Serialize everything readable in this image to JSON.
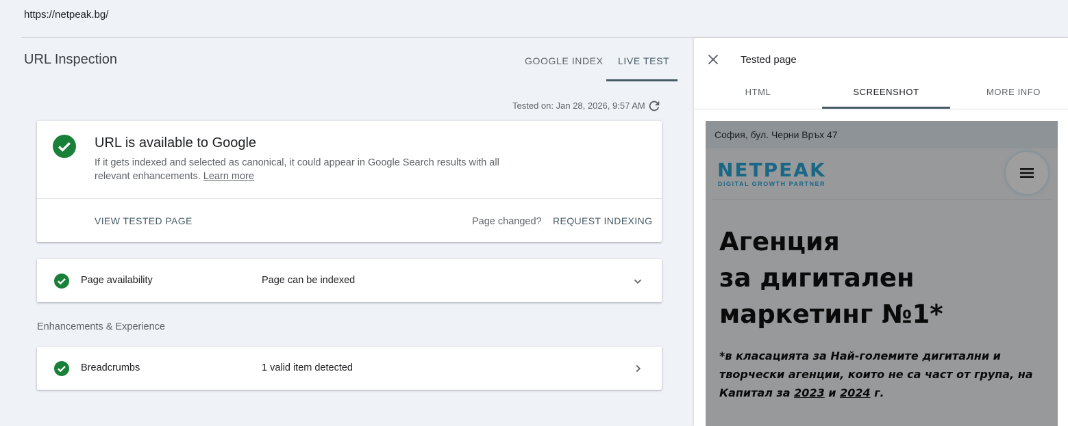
{
  "address_bar": {
    "url": "https://netpeak.bg/"
  },
  "header": {
    "title": "URL Inspection",
    "tabs": [
      {
        "label": "GOOGLE INDEX",
        "active": false
      },
      {
        "label": "LIVE TEST",
        "active": true
      }
    ]
  },
  "test_info": {
    "tested_on": "Tested on: Jan 28, 2026, 9:57 AM",
    "refresh_icon": "refresh-icon"
  },
  "status_card": {
    "icon": "check-circle-icon",
    "headline": "URL is available to Google",
    "description": "If it gets indexed and selected as canonical, it could appear in Google Search results with all relevant enhancements.",
    "learn_more": "Learn more",
    "view_button": "VIEW TESTED PAGE",
    "page_changed": "Page changed?",
    "request_button": "REQUEST INDEXING"
  },
  "availability": {
    "label": "Page availability",
    "value": "Page can be indexed",
    "icon": "chevron-down-icon"
  },
  "enhancements": {
    "section_label": "Enhancements & Experience",
    "items": [
      {
        "label": "Breadcrumbs",
        "value": "1 valid item detected",
        "icon": "chevron-right-icon"
      }
    ]
  },
  "panel": {
    "title": "Tested page",
    "tabs": [
      {
        "label": "HTML",
        "active": false
      },
      {
        "label": "SCREENSHOT",
        "active": true
      },
      {
        "label": "MORE INFO",
        "active": false
      }
    ],
    "screenshot": {
      "address": "София, бул. Черни Връх 47",
      "logo": "NETPEAK",
      "tagline": "DIGITAL GROWTH PARTNER",
      "hero_line1": "Агенция",
      "hero_line2": "за дигитален",
      "hero_line3": "маркетинг №1*",
      "note_part1": "*в класацията за Най-големите дигитални и творчески агенции, които не са част от група, на Капитал за ",
      "note_year1": "2023",
      "note_and": " и ",
      "note_year2": "2024",
      "note_end": " г."
    }
  },
  "colors": {
    "success": "#188038",
    "accent": "#455a64",
    "background": "#eff2f7",
    "brand": "#2aa7d9"
  }
}
